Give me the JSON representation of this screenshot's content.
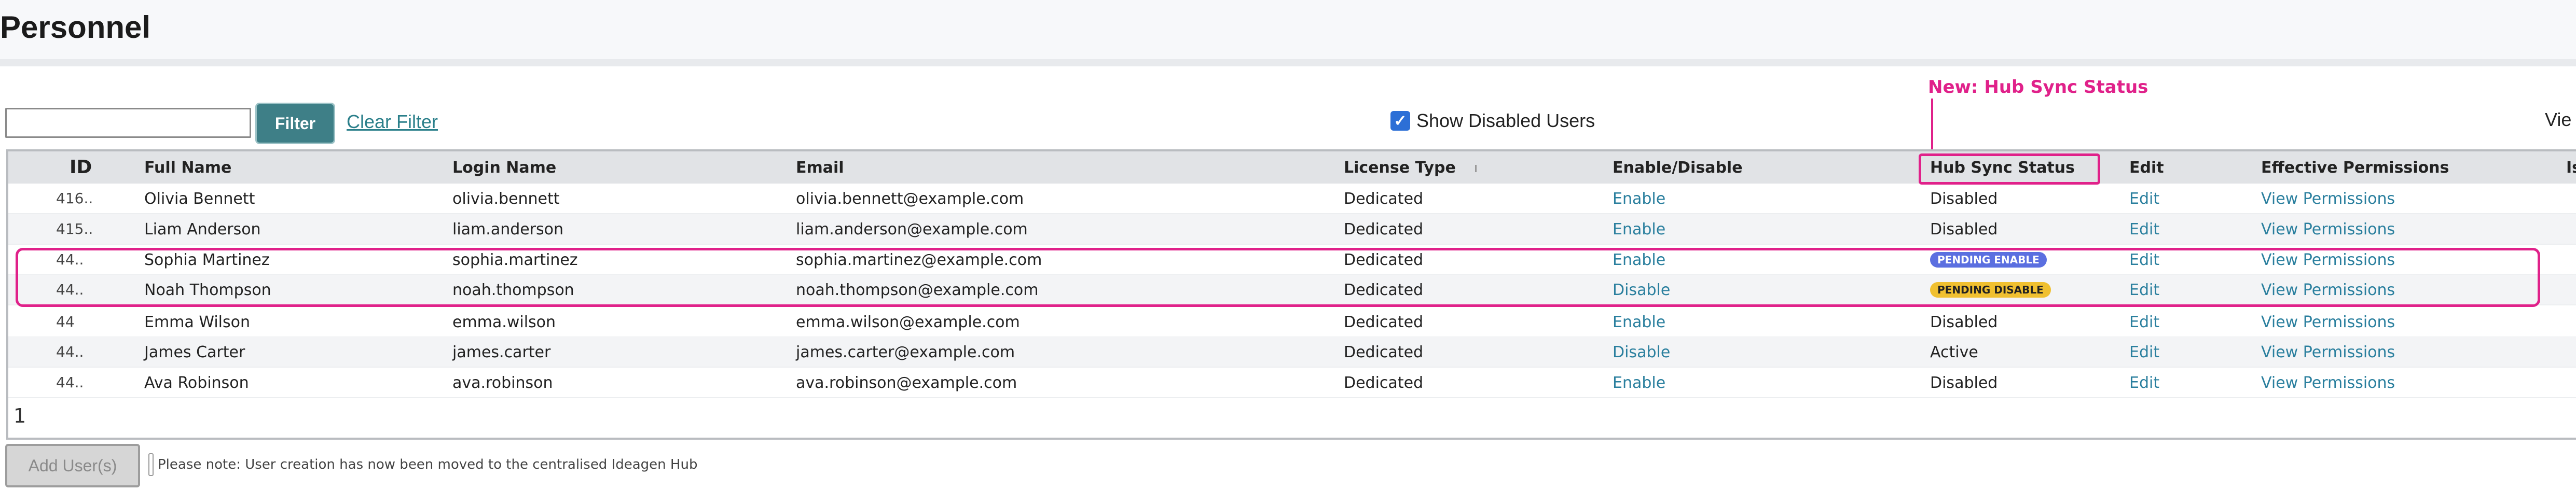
{
  "page": {
    "title": "Personnel"
  },
  "filter": {
    "input_value": "",
    "filter_label": "Filter",
    "clear_label": "Clear Filter",
    "show_disabled_label": "Show Disabled Users",
    "show_disabled_checked": true,
    "right_cut_text": "Vie"
  },
  "annotation": {
    "label": "New: Hub Sync Status",
    "color": "#e0218a"
  },
  "table": {
    "headers": {
      "id": "ID",
      "full_name": "Full Name",
      "login_name": "Login Name",
      "email": "Email",
      "license_type": "License Type",
      "enable_disable": "Enable/Disable",
      "hub_sync": "Hub Sync Status",
      "edit": "Edit",
      "effective_permissions": "Effective Permissions",
      "cut": "Is"
    },
    "rows": [
      {
        "id": "416..",
        "full_name": "Olivia Bennett",
        "login": "olivia.bennett",
        "email": "olivia.bennett@example.com",
        "license": "Dedicated",
        "toggle": "Enable",
        "hub_sync": "Disabled",
        "hub_badge": "",
        "edit": "Edit",
        "perm": "View Permissions"
      },
      {
        "id": "415..",
        "full_name": "Liam Anderson",
        "login": "liam.anderson",
        "email": "liam.anderson@example.com",
        "license": "Dedicated",
        "toggle": "Enable",
        "hub_sync": "Disabled",
        "hub_badge": "",
        "edit": "Edit",
        "perm": "View Permissions"
      },
      {
        "id": "44..",
        "full_name": "Sophia Martinez",
        "login": "sophia.martinez",
        "email": "sophia.martinez@example.com",
        "license": "Dedicated",
        "toggle": "Enable",
        "hub_sync": "",
        "hub_badge": "PENDING ENABLE",
        "edit": "Edit",
        "perm": "View Permissions"
      },
      {
        "id": "44..",
        "full_name": "Noah Thompson",
        "login": "noah.thompson",
        "email": "noah.thompson@example.com",
        "license": "Dedicated",
        "toggle": "Disable",
        "hub_sync": "",
        "hub_badge": "PENDING DISABLE",
        "edit": "Edit",
        "perm": "View Permissions"
      },
      {
        "id": "44",
        "full_name": "Emma Wilson",
        "login": "emma.wilson",
        "email": "emma.wilson@example.com",
        "license": "Dedicated",
        "toggle": "Enable",
        "hub_sync": "Disabled",
        "hub_badge": "",
        "edit": "Edit",
        "perm": "View Permissions"
      },
      {
        "id": "44..",
        "full_name": "James Carter",
        "login": "james.carter",
        "email": "james.carter@example.com",
        "license": "Dedicated",
        "toggle": "Disable",
        "hub_sync": "Active",
        "hub_badge": "",
        "edit": "Edit",
        "perm": "View Permissions"
      },
      {
        "id": "44..",
        "full_name": "Ava Robinson",
        "login": "ava.robinson",
        "email": "ava.robinson@example.com",
        "license": "Dedicated",
        "toggle": "Enable",
        "hub_sync": "Disabled",
        "hub_badge": "",
        "edit": "Edit",
        "perm": "View Permissions"
      }
    ],
    "page_number": "1"
  },
  "footer": {
    "add_user_label": "Add User(s)",
    "note": "Please note: User creation has now been moved to the centralised Ideagen Hub"
  }
}
